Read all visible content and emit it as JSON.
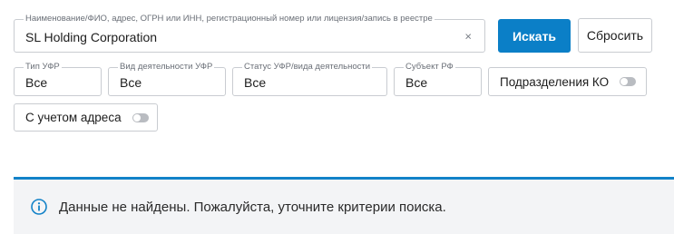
{
  "search": {
    "label": "Наименование/ФИО, адрес, ОГРН или ИНН, регистрационный номер или лицензия/запись в реестре",
    "value": "SL Holding Corporation",
    "clear_glyph": "×"
  },
  "buttons": {
    "search_label": "Искать",
    "reset_label": "Сбросить"
  },
  "filters": [
    {
      "label": "Тип УФР",
      "value": "Все"
    },
    {
      "label": "Вид деятельности УФР",
      "value": "Все"
    },
    {
      "label": "Статус УФР/вида деятельности",
      "value": "Все"
    },
    {
      "label": "Субъект РФ",
      "value": "Все"
    }
  ],
  "toggles": [
    {
      "label": "Подразделения КО",
      "on": false
    },
    {
      "label": "С учетом адреса",
      "on": false
    }
  ],
  "notice": {
    "icon": "info-circle-icon",
    "message": "Данные не найдены. Пожалуйста, уточните критерии поиска."
  },
  "colors": {
    "accent": "#0b7fc7",
    "notice_bg": "#f3f4f6",
    "border": "#c9ccd1"
  }
}
